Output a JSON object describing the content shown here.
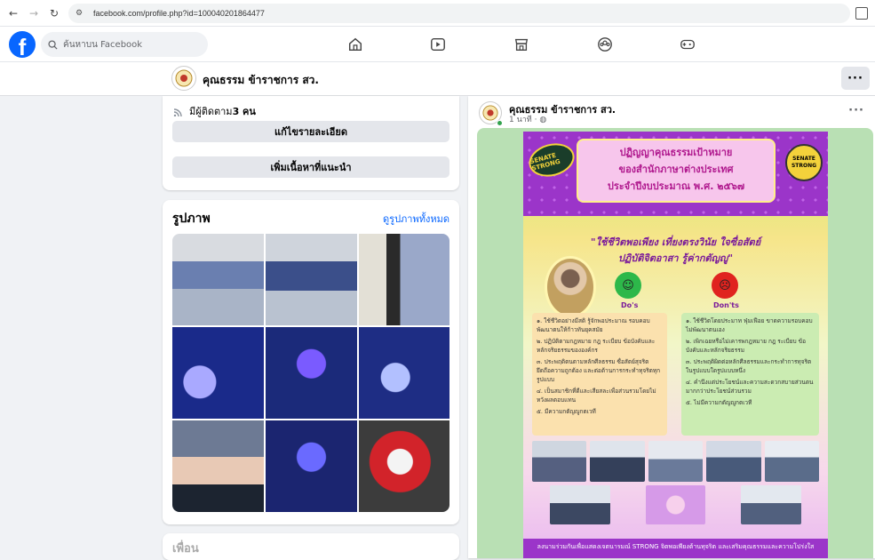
{
  "browser": {
    "url": "facebook.com/profile.php?id=100040201864477"
  },
  "topbar": {
    "logo": "f",
    "search_placeholder": "ค้นหาบน Facebook",
    "icons": [
      "home-icon",
      "video-icon",
      "marketplace-icon",
      "groups-icon",
      "gaming-icon"
    ]
  },
  "profile": {
    "name": "คุณธรรม ข้าราชการ สว.",
    "more": "···"
  },
  "intro": {
    "followers_label": "มีผู้ติดตาม ",
    "followers_count": "3 คน",
    "edit_details": "แก้ไขรายละเอียด",
    "add_featured": "เพิ่มเนื้อหาที่แนะนำ"
  },
  "photos": {
    "title": "รูปภาพ",
    "see_all": "ดูรูปภาพทั้งหมด",
    "tiles": [
      {
        "bg": "linear-gradient(180deg,#d8dbe0 0 30%,#6a7fb0 30% 60%,#a9b4c7 60% 100%)"
      },
      {
        "bg": "linear-gradient(180deg,#cfd4dc 0 30%,#3b4f8a 30% 62%,#b9c2d0 62% 100%)"
      },
      {
        "bg": "linear-gradient(90deg,#e3e0d6 0 30%,#2a2a2a 30% 45%,#9aa8c9 45% 100%)"
      },
      {
        "bg": "radial-gradient(circle at 30% 60%,#a9a9ff 0 18px,#1a2a8a 19px 100%)"
      },
      {
        "bg": "radial-gradient(circle at 50% 40%,#7a5bff 0 16px,#1b2a7a 17px 100%)"
      },
      {
        "bg": "radial-gradient(circle at 40% 55%,#b2c0ff 0 16px,#1e2d84 17px 100%)"
      },
      {
        "bg": "linear-gradient(180deg,#6d7a94 0 40%,#e8c9b5 40% 70%,#1c2430 70% 100%)"
      },
      {
        "bg": "radial-gradient(circle at 50% 40%,#6a6aff 0 16px,#1b2570 17px 100%)"
      },
      {
        "bg": "radial-gradient(circle at 45% 45%,#f4f4f4 0 14px,#d2232a 15px 34px,#3c3c3c 35px 100%)"
      }
    ]
  },
  "next_section": {
    "title": "เพื่อน"
  },
  "post": {
    "author": "คุณธรรม ข้าราชการ สว.",
    "time": "1 นาที · ",
    "more": "···",
    "poster": {
      "title_line1": "ปฏิญญาคุณธรรมเป้าหมาย",
      "title_line2": "ของสำนักภาษาต่างประเทศ",
      "title_line3": "ประจำปีงบประมาณ พ.ศ. ๒๕๖๗",
      "logo_left": "SENATE STRONG",
      "logo_right": "SENATE STRONG",
      "motto_line1": "\"ใช้ชีวิตพอเพียง เที่ยงตรงวินัย ใจซื่อสัตย์",
      "motto_line2": "ปฏิบัติจิตอาสา รู้ค่ากตัญญู\"",
      "dos": "Do's",
      "donts": "Don'ts",
      "do_items": [
        "๑. ใช้ชีวิตอย่างมีสติ รู้จักพอประมาณ รอบคอบ พัฒนาตนให้ก้าวทันยุคสมัย",
        "๒. ปฏิบัติตามกฎหมาย กฎ ระเบียบ ข้อบังคับและหลักจริยธรรมขององค์กร",
        "๓. ประพฤติตนตามหลักศีลธรรม ซื่อสัตย์สุจริต ยึดถือความถูกต้อง และต่อต้านการกระทำทุจริตทุกรูปแบบ",
        "๔. เป็นสมาชิกที่ดีและเสียสละเพื่อส่วนรวมโดยไม่หวังผลตอบแทน",
        "๕. มีความกตัญญูกตเวที"
      ],
      "dont_items": [
        "๑. ใช้ชีวิตโดยประมาท ฟุ่มเฟือย ขาดความรอบคอบ ไม่พัฒนาตนเอง",
        "๒. เพิกเฉยหรือไม่เคารพกฎหมาย กฎ ระเบียบ ข้อบังคับและหลักจริยธรรม",
        "๓. ประพฤติผิดต่อหลักศีลธรรมและกระทำการทุจริตในรูปแบบใดรูปแบบหนึ่ง",
        "๔. คำนึงแต่ประโยชน์และความสะดวกสบายส่วนตนมากกว่าประโยชน์ส่วนรวม",
        "๕. ไม่มีความกตัญญูกตเวที"
      ],
      "footer": "ลงนามร่วมกันเพื่อแสดงเจตนารมณ์ STRONG จิตพอเพียงต้านทุจริต และเสริมคุณธรรมและความโปร่งใส"
    }
  }
}
